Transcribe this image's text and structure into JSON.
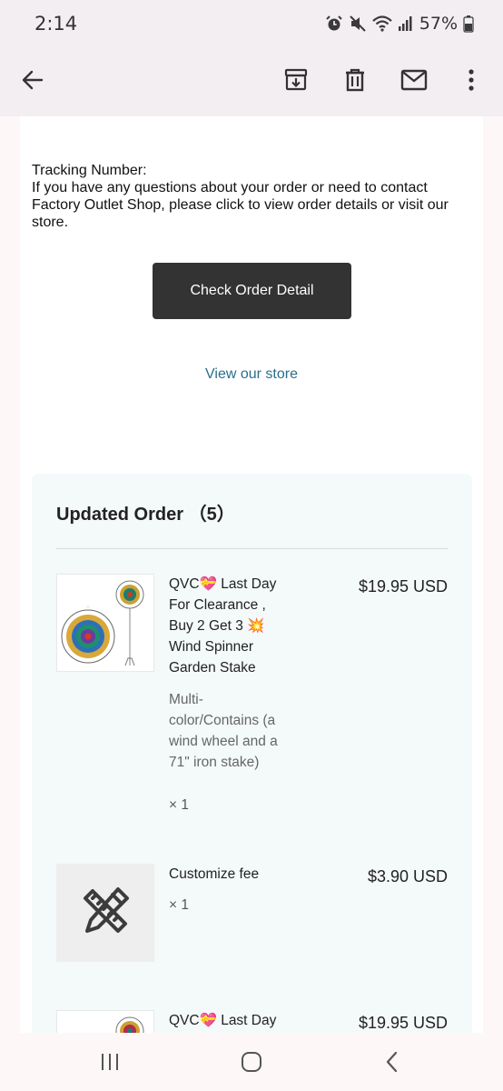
{
  "status_bar": {
    "time": "2:14",
    "battery": "57%",
    "icons": [
      "alarm-icon",
      "mute-icon",
      "wifi-icon",
      "signal-icon",
      "battery-icon"
    ]
  },
  "app_bar": {
    "icons": [
      "back-arrow-icon",
      "archive-icon",
      "delete-icon",
      "mark-unread-icon",
      "more-vert-icon"
    ]
  },
  "email": {
    "tracking_label": "Tracking Number:",
    "tracking_text": "If you have any questions about your order or need to contact Factory Outlet Shop, please click to view order details or visit our store.",
    "check_button": "Check Order Detail",
    "store_link": "View our store",
    "order_title": "Updated Order （5）",
    "items": [
      {
        "name": "QVC💝 Last Day For Clearance , Buy 2 Get 3 💥 Wind Spinner Garden Stake",
        "variant": "Multi-color/Contains (a wind wheel and a 71\" iron stake)",
        "qty": "× 1",
        "price": "$19.95 USD"
      },
      {
        "name": "Customize fee",
        "qty": "× 1",
        "price": "$3.90 USD"
      },
      {
        "name": "QVC💝 Last Day",
        "price": "$19.95 USD"
      }
    ]
  },
  "nav_bar": {
    "icons": [
      "recent-apps-icon",
      "home-icon",
      "back-nav-icon"
    ]
  },
  "colors": {
    "button_bg": "#333333",
    "link": "#2a6f8a",
    "order_box_bg": "#f4f9fa"
  }
}
